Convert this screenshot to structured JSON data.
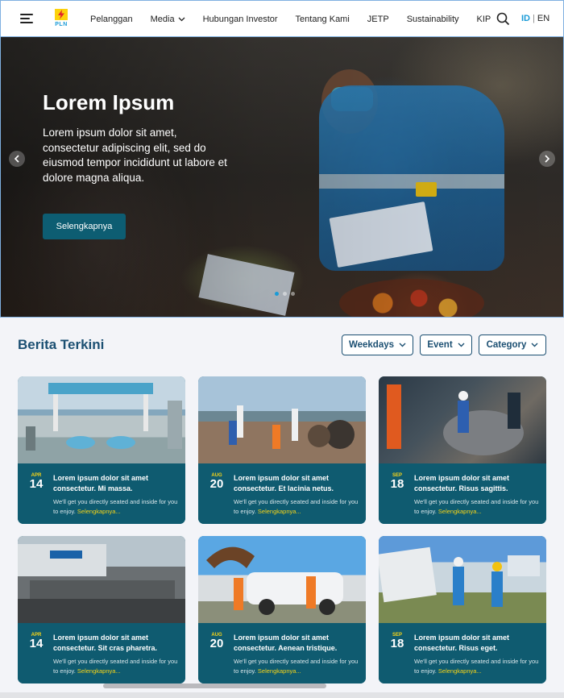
{
  "header": {
    "logo_text": "PLN",
    "nav": [
      {
        "label": "Pelanggan",
        "has_dropdown": false
      },
      {
        "label": "Media",
        "has_dropdown": true
      },
      {
        "label": "Hubungan Investor",
        "has_dropdown": false
      },
      {
        "label": "Tentang Kami",
        "has_dropdown": false
      },
      {
        "label": "JETP",
        "has_dropdown": false
      },
      {
        "label": "Sustainability",
        "has_dropdown": false
      },
      {
        "label": "KIP",
        "has_dropdown": false
      }
    ],
    "lang_active": "ID",
    "lang_separator": "|",
    "lang_other": "EN"
  },
  "hero": {
    "title": "Lorem Ipsum",
    "description": "Lorem ipsum dolor sit amet, consectetur adipiscing elit, sed do eiusmod tempor incididunt ut labore et dolore magna aliqua.",
    "button_label": "Selengkapnya"
  },
  "news": {
    "title": "Berita Terkini",
    "filters": [
      {
        "label": "Weekdays"
      },
      {
        "label": "Event"
      },
      {
        "label": "Category"
      }
    ],
    "cards": [
      {
        "month": "APR",
        "day": "14",
        "title": "Lorem ipsum dolor sit amet consectetur. Mi massa.",
        "excerpt": "We'll get you directly seated and inside for you to enjoy.",
        "more": "Selengkapnya..."
      },
      {
        "month": "AUG",
        "day": "20",
        "title": "Lorem ipsum dolor sit amet consectetur. Et lacinia netus.",
        "excerpt": "We'll get you directly seated and inside for you to enjoy.",
        "more": "Selengkapnya..."
      },
      {
        "month": "SEP",
        "day": "18",
        "title": "Lorem ipsum dolor sit amet consectetur. Risus sagittis.",
        "excerpt": "We'll get you directly seated and inside for you to enjoy.",
        "more": "Selengkapnya..."
      },
      {
        "month": "APR",
        "day": "14",
        "title": "Lorem ipsum dolor sit amet consectetur. Sit cras pharetra.",
        "excerpt": "We'll get you directly seated and inside for you to enjoy.",
        "more": "Selengkapnya..."
      },
      {
        "month": "AUG",
        "day": "20",
        "title": "Lorem ipsum dolor sit amet consectetur. Aenean tristique.",
        "excerpt": "We'll get you directly seated and inside for you to enjoy.",
        "more": "Selengkapnya..."
      },
      {
        "month": "SEP",
        "day": "18",
        "title": "Lorem ipsum dolor sit amet consectetur. Risus eget.",
        "excerpt": "We'll get you directly seated and inside for you to enjoy.",
        "more": "Selengkapnya..."
      }
    ]
  },
  "colors": {
    "brand_blue": "#1a9bd7",
    "brand_yellow": "#fcd20b",
    "card_bg": "#0f5b70",
    "heading": "#1b4f72",
    "date_month": "#f7d417"
  },
  "icons": [
    "hamburger-menu-icon",
    "pln-logo",
    "chevron-down-icon",
    "search-icon",
    "chevron-left-icon",
    "chevron-right-icon"
  ]
}
